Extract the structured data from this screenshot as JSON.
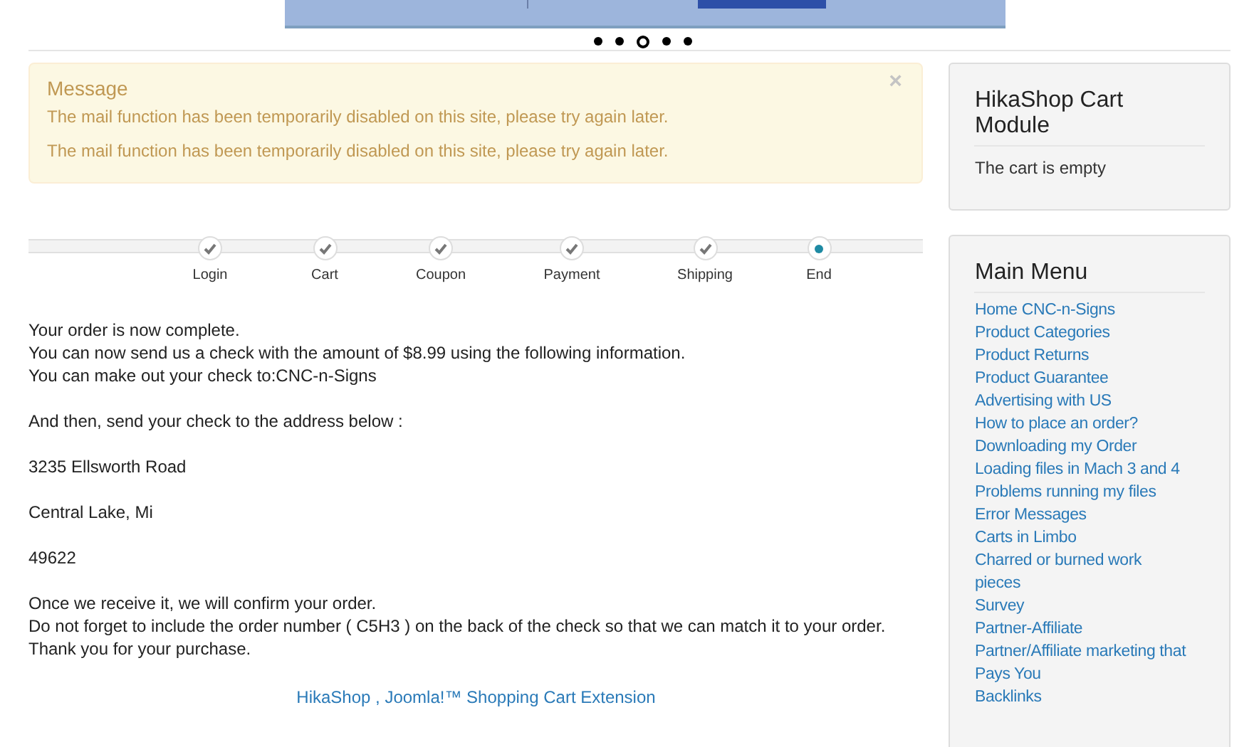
{
  "slider": {
    "dots": [
      {
        "selected": false
      },
      {
        "selected": false
      },
      {
        "selected": true
      },
      {
        "selected": false
      },
      {
        "selected": false
      }
    ]
  },
  "message": {
    "title": "Message",
    "close": "×",
    "lines": [
      "The mail function has been temporarily disabled on this site, please try again later.",
      "The mail function has been temporarily disabled on this site, please try again later."
    ]
  },
  "steps": [
    {
      "label": "Login",
      "done": true
    },
    {
      "label": "Cart",
      "done": true
    },
    {
      "label": "Coupon",
      "done": true
    },
    {
      "label": "Payment",
      "done": true
    },
    {
      "label": "Shipping",
      "done": true
    },
    {
      "label": "End",
      "done": false
    }
  ],
  "order_text": [
    [
      "Your order is now complete.",
      "You can now send us a check with the amount of $8.99 using the following information.",
      "You can make out your check to:CNC-n-Signs"
    ],
    [
      "And then, send your check to the address below :"
    ],
    [
      "3235 Ellsworth Road"
    ],
    [
      "Central Lake, Mi"
    ],
    [
      "49622"
    ],
    [
      "Once we receive it, we will confirm your order.",
      "Do not forget to include the order number ( C5H3 ) on the back of the check so that we can match it to your order.",
      "Thank you for your purchase."
    ]
  ],
  "footer_link": "HikaShop , Joomla!™ Shopping Cart Extension",
  "cart_module": {
    "title": "HikaShop Cart Module",
    "text": "The cart is empty"
  },
  "main_menu": {
    "title": "Main Menu",
    "items": [
      "Home CNC-n-Signs",
      "Product Categories",
      "Product Returns",
      "Product Guarantee",
      "Advertising with US",
      "How to place an order?",
      "Downloading my Order",
      "Loading files in Mach 3 and 4",
      "Problems running my files",
      "Error Messages",
      "Carts in Limbo",
      "Charred or burned work pieces",
      "Survey",
      "Partner-Affiliate",
      "Partner/Affiliate marketing that Pays You",
      "Backlinks"
    ]
  }
}
